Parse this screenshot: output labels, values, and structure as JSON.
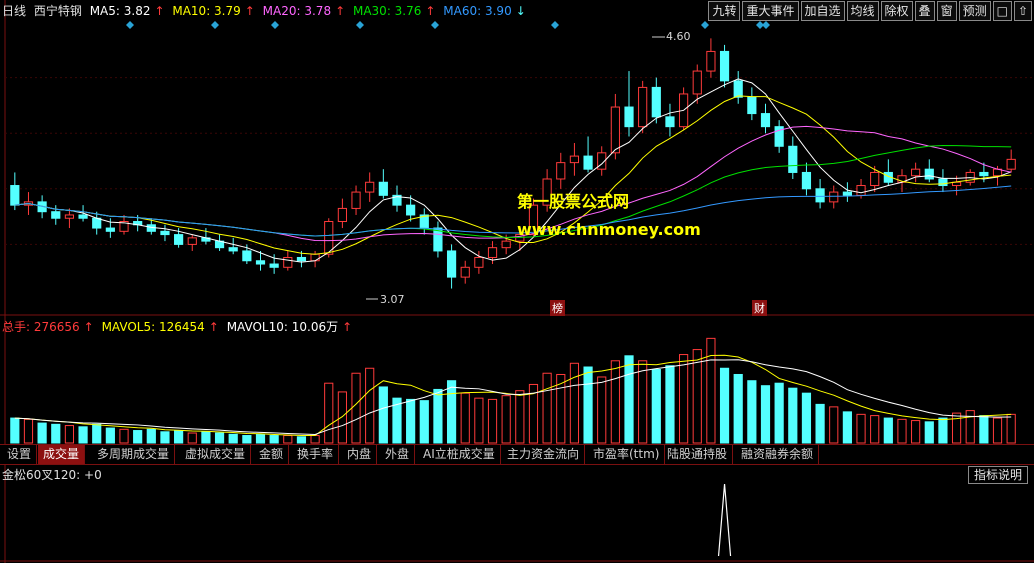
{
  "price_header": {
    "period": "日线",
    "stock_name": "西宁特钢",
    "ma5": "MA5: 3.82",
    "ma10": "MA10: 3.79",
    "ma20": "MA20: 3.78",
    "ma30": "MA30: 3.76",
    "ma60": "MA60: 3.90",
    "up_arrow": "↑",
    "down_arrow": "↓"
  },
  "toolbar": [
    "九转",
    "重大事件",
    "加自选",
    "均线",
    "除权",
    "叠",
    "窗",
    "预测"
  ],
  "annotations": {
    "high": "4.60",
    "low": "3.07",
    "tag_bang": "榜",
    "tag_cai": "财"
  },
  "watermark": {
    "title": "第一股票公式网",
    "url": "www.chnmoney.com"
  },
  "volume_header": {
    "total": "总手: 276656",
    "mavol5": "MAVOL5: 126454",
    "mavol10": "MAVOL10: 10.06万",
    "up_arrow": "↑"
  },
  "tabs": [
    "设置",
    "成交量",
    "多周期成交量",
    "虚拟成交量",
    "金额",
    "换手率",
    "内盘",
    "外盘",
    "AI立桩成交量",
    "主力资金流向",
    "市盈率(ttm)",
    "陆股通持股",
    "融资融券余额"
  ],
  "indicator": {
    "title": "金松60叉120: +0",
    "explain_button": "指标说明"
  },
  "colors": {
    "up": "#ff3b3b",
    "down": "#54ffff",
    "ma5": "#ffffff",
    "ma10": "#ffff00",
    "ma20": "#ff66ff",
    "ma30": "#00e000",
    "ma60": "#3399ff",
    "grid": "#7a1010"
  },
  "chart_data": {
    "type": "candlestick",
    "ohlc": [
      [
        3.7,
        3.78,
        3.55,
        3.58
      ],
      [
        3.58,
        3.66,
        3.52,
        3.6
      ],
      [
        3.6,
        3.64,
        3.5,
        3.54
      ],
      [
        3.54,
        3.58,
        3.46,
        3.5
      ],
      [
        3.5,
        3.56,
        3.44,
        3.52
      ],
      [
        3.52,
        3.58,
        3.48,
        3.5
      ],
      [
        3.5,
        3.54,
        3.4,
        3.44
      ],
      [
        3.44,
        3.5,
        3.38,
        3.42
      ],
      [
        3.42,
        3.52,
        3.4,
        3.48
      ],
      [
        3.48,
        3.52,
        3.42,
        3.46
      ],
      [
        3.46,
        3.5,
        3.4,
        3.42
      ],
      [
        3.42,
        3.46,
        3.36,
        3.4
      ],
      [
        3.4,
        3.44,
        3.32,
        3.34
      ],
      [
        3.34,
        3.4,
        3.3,
        3.38
      ],
      [
        3.38,
        3.44,
        3.34,
        3.36
      ],
      [
        3.36,
        3.4,
        3.3,
        3.32
      ],
      [
        3.32,
        3.38,
        3.28,
        3.3
      ],
      [
        3.3,
        3.34,
        3.22,
        3.24
      ],
      [
        3.24,
        3.3,
        3.18,
        3.22
      ],
      [
        3.22,
        3.28,
        3.16,
        3.2
      ],
      [
        3.2,
        3.3,
        3.18,
        3.26
      ],
      [
        3.26,
        3.3,
        3.2,
        3.24
      ],
      [
        3.24,
        3.3,
        3.2,
        3.28
      ],
      [
        3.28,
        3.5,
        3.26,
        3.48
      ],
      [
        3.48,
        3.62,
        3.44,
        3.56
      ],
      [
        3.56,
        3.7,
        3.52,
        3.66
      ],
      [
        3.66,
        3.78,
        3.6,
        3.72
      ],
      [
        3.72,
        3.8,
        3.62,
        3.64
      ],
      [
        3.64,
        3.7,
        3.54,
        3.58
      ],
      [
        3.58,
        3.64,
        3.48,
        3.52
      ],
      [
        3.52,
        3.56,
        3.4,
        3.44
      ],
      [
        3.44,
        3.48,
        3.26,
        3.3
      ],
      [
        3.3,
        3.34,
        3.07,
        3.14
      ],
      [
        3.14,
        3.24,
        3.1,
        3.2
      ],
      [
        3.2,
        3.3,
        3.16,
        3.26
      ],
      [
        3.26,
        3.36,
        3.22,
        3.32
      ],
      [
        3.32,
        3.4,
        3.28,
        3.36
      ],
      [
        3.36,
        3.44,
        3.3,
        3.4
      ],
      [
        3.4,
        3.62,
        3.38,
        3.58
      ],
      [
        3.58,
        3.8,
        3.54,
        3.74
      ],
      [
        3.74,
        3.9,
        3.68,
        3.84
      ],
      [
        3.84,
        3.96,
        3.76,
        3.88
      ],
      [
        3.88,
        4.0,
        3.78,
        3.8
      ],
      [
        3.8,
        3.94,
        3.76,
        3.9
      ],
      [
        3.9,
        4.26,
        3.86,
        4.18
      ],
      [
        4.18,
        4.4,
        4.0,
        4.06
      ],
      [
        4.06,
        4.34,
        4.02,
        4.3
      ],
      [
        4.3,
        4.36,
        4.08,
        4.12
      ],
      [
        4.12,
        4.2,
        4.0,
        4.06
      ],
      [
        4.06,
        4.3,
        4.04,
        4.26
      ],
      [
        4.26,
        4.44,
        4.2,
        4.4
      ],
      [
        4.4,
        4.6,
        4.36,
        4.52
      ],
      [
        4.52,
        4.56,
        4.3,
        4.34
      ],
      [
        4.34,
        4.4,
        4.2,
        4.24
      ],
      [
        4.24,
        4.3,
        4.1,
        4.14
      ],
      [
        4.14,
        4.2,
        4.02,
        4.06
      ],
      [
        4.06,
        4.1,
        3.9,
        3.94
      ],
      [
        3.94,
        4.0,
        3.74,
        3.78
      ],
      [
        3.78,
        3.84,
        3.64,
        3.68
      ],
      [
        3.68,
        3.74,
        3.56,
        3.6
      ],
      [
        3.6,
        3.7,
        3.56,
        3.66
      ],
      [
        3.66,
        3.72,
        3.6,
        3.64
      ],
      [
        3.64,
        3.74,
        3.62,
        3.7
      ],
      [
        3.7,
        3.82,
        3.66,
        3.78
      ],
      [
        3.78,
        3.86,
        3.7,
        3.72
      ],
      [
        3.72,
        3.8,
        3.66,
        3.76
      ],
      [
        3.76,
        3.84,
        3.72,
        3.8
      ],
      [
        3.8,
        3.86,
        3.72,
        3.74
      ],
      [
        3.74,
        3.8,
        3.66,
        3.7
      ],
      [
        3.7,
        3.76,
        3.64,
        3.72
      ],
      [
        3.72,
        3.8,
        3.7,
        3.78
      ],
      [
        3.78,
        3.84,
        3.72,
        3.76
      ],
      [
        3.76,
        3.82,
        3.7,
        3.8
      ],
      [
        3.8,
        3.92,
        3.78,
        3.86
      ]
    ],
    "volume": [
      40,
      38,
      32,
      30,
      28,
      26,
      30,
      24,
      22,
      20,
      22,
      18,
      20,
      16,
      18,
      16,
      14,
      12,
      14,
      12,
      12,
      10,
      12,
      96,
      82,
      112,
      120,
      90,
      72,
      70,
      68,
      86,
      100,
      80,
      72,
      70,
      76,
      84,
      94,
      112,
      110,
      128,
      122,
      106,
      132,
      140,
      132,
      118,
      124,
      142,
      150,
      168,
      120,
      110,
      100,
      92,
      96,
      88,
      80,
      62,
      58,
      50,
      46,
      44,
      40,
      38,
      36,
      34,
      40,
      48,
      52,
      44,
      40,
      46
    ],
    "ylim": [
      3.0,
      4.7
    ],
    "indicator_signal_index": 52
  }
}
